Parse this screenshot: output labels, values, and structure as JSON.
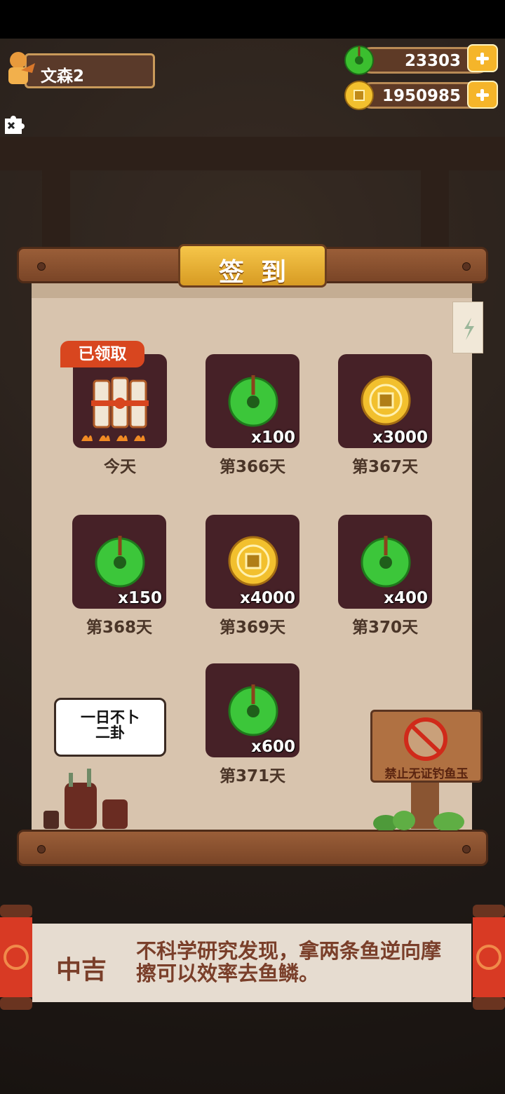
{
  "player": {
    "name": "文森2"
  },
  "currencies": {
    "jade": {
      "value": "23303",
      "icon": "jade-icon"
    },
    "coins": {
      "value": "1950985",
      "icon": "coin-icon"
    }
  },
  "checkin": {
    "title": "签到",
    "claimed_badge": "已领取",
    "items": [
      {
        "day": "今天",
        "reward": "firecracker",
        "qty": "",
        "claimed": true
      },
      {
        "day": "第366天",
        "reward": "jade",
        "qty": "x100"
      },
      {
        "day": "第367天",
        "reward": "coin",
        "qty": "x3000"
      },
      {
        "day": "第368天",
        "reward": "jade",
        "qty": "x150"
      },
      {
        "day": "第369天",
        "reward": "coin",
        "qty": "x4000"
      },
      {
        "day": "第370天",
        "reward": "jade",
        "qty": "x400"
      },
      {
        "day": "第371天",
        "reward": "jade",
        "qty": "x600"
      }
    ]
  },
  "bubble": {
    "text": "一日不卜\n二卦"
  },
  "sign": {
    "text": "禁止无证钓鱼玉"
  },
  "fortune": {
    "level": "中吉",
    "text": "不科学研究发现，拿两条鱼逆向摩擦可以效率去鱼鳞。"
  },
  "colors": {
    "card_bg": "#462127",
    "paper": "#d8c4ae",
    "badge": "#d8461f",
    "title_tab": "#f6c64a"
  }
}
